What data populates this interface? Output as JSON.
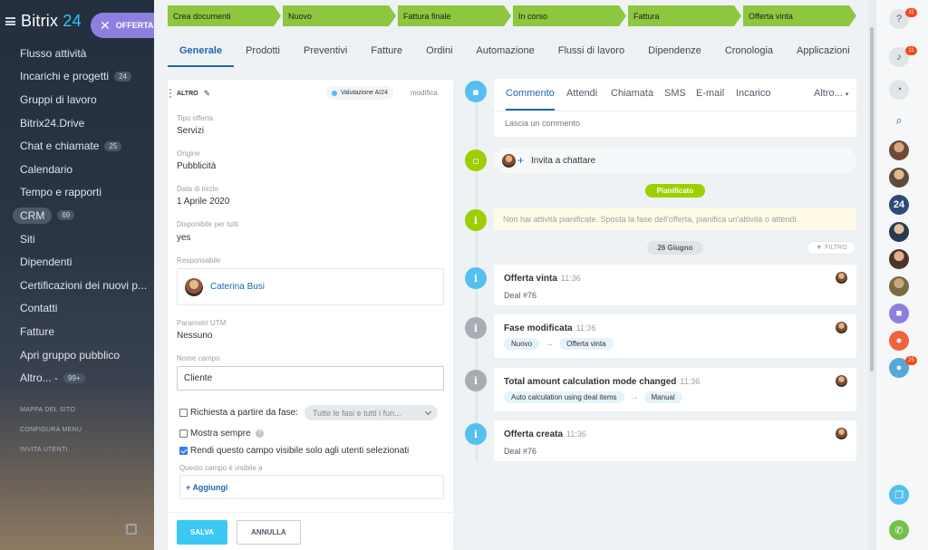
{
  "brand": {
    "name": "Bitrix",
    "num": "24",
    "deal_pill": "OFFERTA"
  },
  "sidebar": {
    "items": [
      {
        "label": "Flusso attività"
      },
      {
        "label": "Incarichi e progetti",
        "count": "24"
      },
      {
        "label": "Gruppi di lavoro"
      },
      {
        "label": "Bitrix24.Drive"
      },
      {
        "label": "Chat e chiamate",
        "count": "25"
      },
      {
        "label": "Calendario"
      },
      {
        "label": "Tempo e rapporti"
      },
      {
        "label": "CRM",
        "count": "69"
      },
      {
        "label": "Siti"
      },
      {
        "label": "Dipendenti"
      },
      {
        "label": "Certificazioni dei nuovi p..."
      },
      {
        "label": "Contatti"
      },
      {
        "label": "Fatture"
      },
      {
        "label": "Apri gruppo pubblico"
      },
      {
        "label": "Altro... -",
        "count": "99+"
      }
    ],
    "links": [
      "MAPPA DEL SITO",
      "CONFIGURA MENU",
      "INVITA UTENTI"
    ]
  },
  "stages": [
    "Crea documenti",
    "Nuovo",
    "Fattura finale",
    "In corso",
    "Fattura",
    "Offerta vinta"
  ],
  "tabs": [
    "Generale",
    "Prodotti",
    "Preventivi",
    "Fatture",
    "Ordini",
    "Automazione",
    "Flussi di lavoro",
    "Dipendenze",
    "Cronologia",
    "Applicazioni"
  ],
  "form": {
    "section": "ALTRO",
    "ai_chip": "Valutazione AI24",
    "modify": "modifica",
    "fields": [
      {
        "label": "Tipo offerta",
        "value": "Servizi"
      },
      {
        "label": "Origine",
        "value": "Pubblicità"
      },
      {
        "label": "Data di inizio",
        "value": "1 Aprile 2020"
      },
      {
        "label": "Disponibile per tutti",
        "value": "yes"
      }
    ],
    "responsible_label": "Responsabile",
    "responsible_name": "Caterina Busi",
    "utm_label": "Parametri UTM",
    "utm_value": "Nessuno",
    "name_field_label": "Nome campo",
    "name_field_value": "Cliente",
    "required_label": "Richiesta a partire da fase:",
    "required_select": "Tutte le fasi e tutti i fun...",
    "show_always": "Mostra sempre",
    "visible_selected": "Rendi questo campo visibile solo agli utenti selezionati",
    "visible_to_label": "Questo campo è visibile a",
    "add": "Aggiungi",
    "save": "SALVA",
    "cancel": "ANNULLA"
  },
  "timeline": {
    "comm_tabs": [
      "Commento",
      "Attendi",
      "Chiamata",
      "SMS",
      "E-mail",
      "Incarico",
      "Altro..."
    ],
    "comment_placeholder": "Lascia un commento",
    "invite": "Invita a chattare",
    "planned": "Pianificato",
    "no_activities": "Non hai attività pianificate. Sposta la fase dell'offerta, pianifica un'attività o attendi.",
    "date": "26 Giugno",
    "filter": "FILTRO",
    "events": [
      {
        "title": "Offerta vinta",
        "time": "11:36",
        "sub": "Deal #76"
      },
      {
        "title": "Fase modificata",
        "time": "11:36",
        "from": "Nuovo",
        "to": "Offerta vinta"
      },
      {
        "title": "Total amount calculation mode changed",
        "time": "11:36",
        "from": "Auto calculation using deal items",
        "to": "Manual"
      },
      {
        "title": "Offerta creata",
        "time": "11:36",
        "sub": "Deal #76"
      }
    ]
  },
  "rightbar": {
    "badge_help": "11",
    "badge_notif": "11",
    "badge_24": "24",
    "badge_people": "25"
  }
}
